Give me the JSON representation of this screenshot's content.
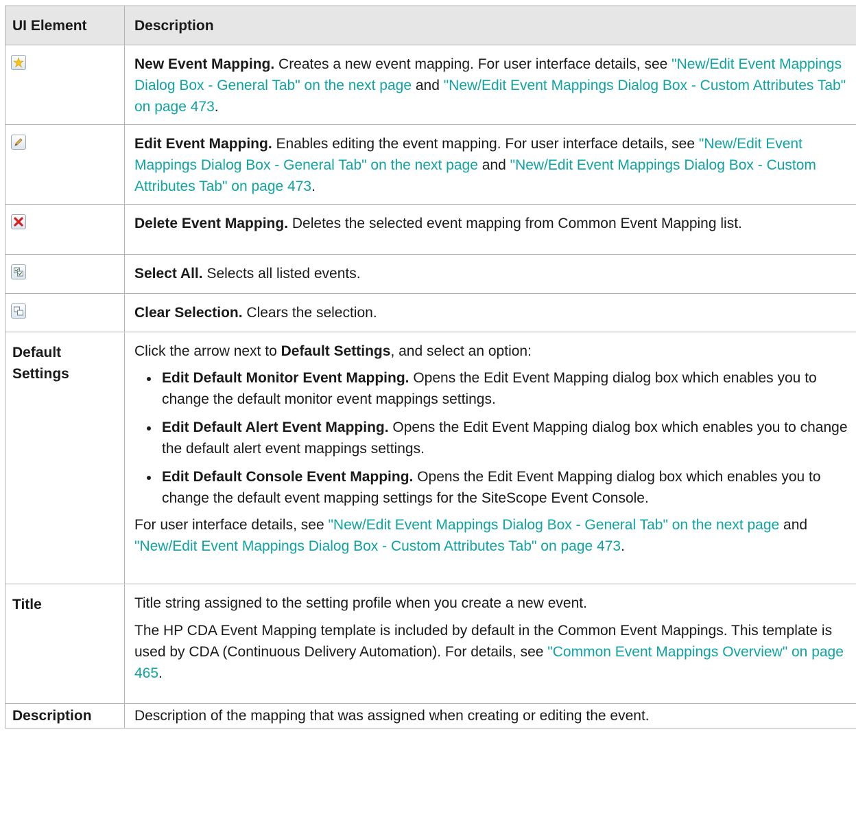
{
  "table": {
    "headers": {
      "element": "UI Element",
      "description": "Description"
    }
  },
  "rows": {
    "new": {
      "icon": "new-star-icon",
      "title": "New Event Mapping.",
      "text": " Creates a new event mapping. For user interface details, see ",
      "link1": "\"New/Edit Event Mappings Dialog Box - General Tab\" on the next page",
      "and": " and ",
      "link2": "\"New/Edit Event Mappings Dialog Box - Custom Attributes Tab\" on page 473",
      "end": "."
    },
    "edit": {
      "icon": "pencil-icon",
      "title": "Edit Event Mapping.",
      "text": " Enables editing the event mapping. For user interface details, see ",
      "link1": "\"New/Edit Event Mappings Dialog Box - General Tab\" on the next page",
      "and": " and ",
      "link2": "\"New/Edit Event Mappings Dialog Box - Custom Attributes Tab\" on page 473",
      "end": "."
    },
    "delete": {
      "icon": "red-x-delete-icon",
      "title": "Delete Event Mapping.",
      "text": " Deletes the selected event mapping from Common Event Mapping list."
    },
    "select_all": {
      "icon": "select-all-icon",
      "title": "Select All.",
      "text": " Selects all listed events."
    },
    "clear": {
      "icon": "clear-selection-icon",
      "title": "Clear Selection.",
      "text": " Clears the selection."
    },
    "default_settings": {
      "label": "Default Settings",
      "intro_pre": "Click the arrow next to ",
      "intro_bold": "Default Settings",
      "intro_post": ", and select an option:",
      "options": [
        {
          "title": "Edit Default Monitor Event Mapping.",
          "text": " Opens the Edit Event Mapping dialog box which enables you to change the default monitor event mappings settings."
        },
        {
          "title": "Edit Default Alert Event Mapping.",
          "text": " Opens the Edit Event Mapping dialog box which enables you to change the default alert event mappings settings."
        },
        {
          "title": "Edit Default Console Event Mapping.",
          "text": " Opens the Edit Event Mapping dialog box which enables you to change the default event mapping settings for the SiteScope Event Console."
        }
      ],
      "footer_pre": "For user interface details, see ",
      "link1": "\"New/Edit Event Mappings Dialog Box - General Tab\" on the next page",
      "and": " and ",
      "link2": "\"New/Edit Event Mappings Dialog Box - Custom Attributes Tab\" on page 473",
      "end": "."
    },
    "title": {
      "label": "Title",
      "para1": "Title string assigned to the setting profile when you create a new event.",
      "para2": "The HP CDA Event Mapping template is included by default in the Common Event Mappings. This template is used by CDA (Continuous Delivery Automation). For details, see ",
      "link": "\"Common Event Mappings Overview\" on page 465",
      "end": "."
    },
    "description": {
      "label": "Description",
      "text": "Description of the mapping that was assigned when creating or editing the event."
    }
  }
}
